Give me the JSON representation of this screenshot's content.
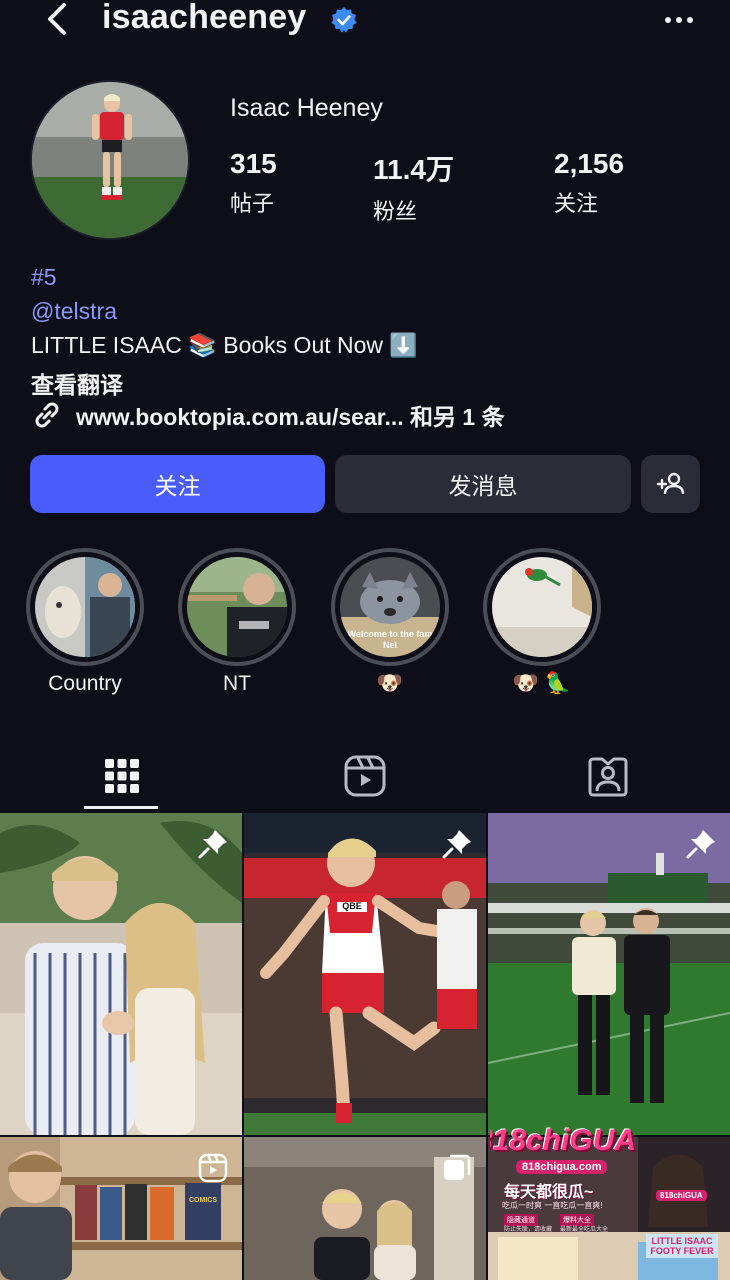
{
  "header": {
    "username": "isaacheeney",
    "back_icon": "chevron-left-icon",
    "verified_icon": "verified-badge-icon",
    "more_icon": "more-horizontal-icon"
  },
  "profile": {
    "full_name": "Isaac Heeney",
    "stats": [
      {
        "value": "315",
        "label": "帖子"
      },
      {
        "value": "11.4万",
        "label": "粉丝"
      },
      {
        "value": "2,156",
        "label": "关注"
      }
    ]
  },
  "bio": {
    "line1": "#5",
    "line2": "@telstra",
    "line3": "LITTLE ISAAC 📚 Books Out Now ⬇️",
    "translate": "查看翻译",
    "link_text": "www.booktopia.com.au/sear... 和另 1 条"
  },
  "actions": {
    "follow": "关注",
    "message": "发消息",
    "add_person_icon": "add-person-icon"
  },
  "highlights": [
    {
      "label": "Country"
    },
    {
      "label": "NT"
    },
    {
      "label": "🐶",
      "thumb_text": "Welcome to the fam Nel"
    },
    {
      "label": "🐶 🦜"
    }
  ],
  "tabs": [
    {
      "name": "posts",
      "icon": "grid-icon",
      "active": true
    },
    {
      "name": "reels",
      "icon": "reels-icon",
      "active": false
    },
    {
      "name": "tagged",
      "icon": "tagged-person-icon",
      "active": false
    }
  ],
  "posts": [
    {
      "pinned": true
    },
    {
      "pinned": true,
      "shirt_text": "QBE"
    },
    {
      "pinned": true
    },
    {
      "type": "reel",
      "shelf_text": "COMICS"
    },
    {
      "type": "carousel"
    },
    {
      "ad": true
    }
  ],
  "ad_overlay": {
    "logo": "818chiGUA",
    "url": "818chigua.com",
    "headline": "每天都很瓜~",
    "tagline": "吃瓜一时爽 一直吃瓜一直爽!",
    "tag1": "隐藏通道",
    "tag2": "爆料大全",
    "sub1": "防止失联，请收藏",
    "sub2": "最新最全吃瓜大全",
    "side_text": "818chiGUA",
    "book_cover": "LITTLE ISAAC FOOTY FEVER"
  },
  "colors": {
    "background": "#0d0e17",
    "follow_button": "#4a5cfa",
    "secondary_button": "#2a2c38",
    "link": "#8c97ff",
    "verified": "#3d8bf2"
  }
}
